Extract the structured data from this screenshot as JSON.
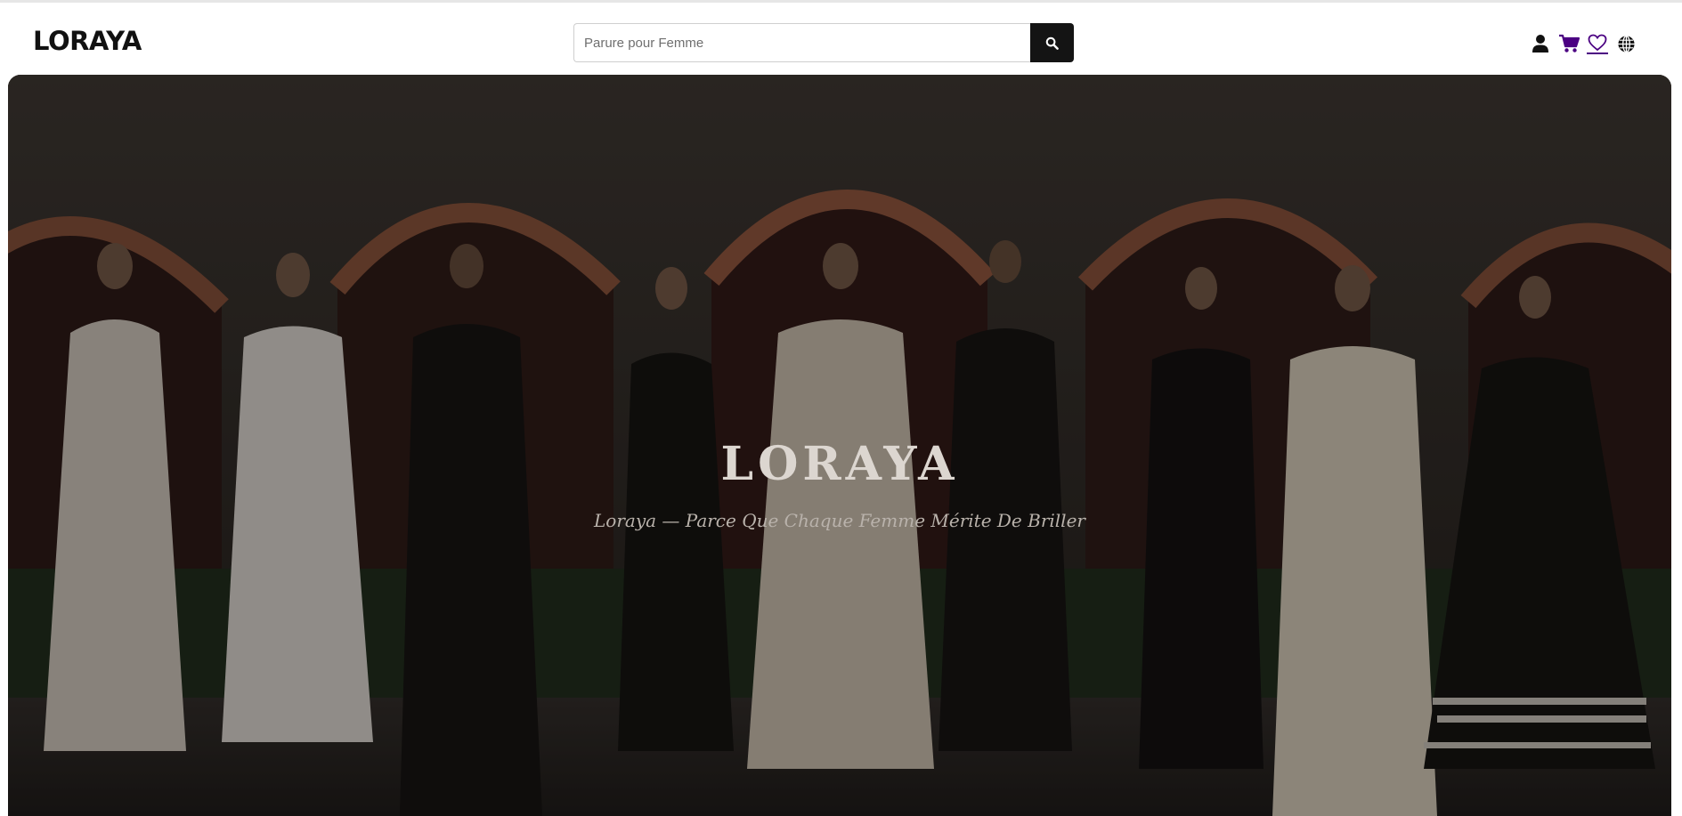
{
  "header": {
    "logo": "LORAYA",
    "search": {
      "placeholder": "Parure pour Femme",
      "value": ""
    },
    "icons": {
      "account": "user-icon",
      "cart": "cart-icon",
      "wishlist": "heart-icon",
      "language": "globe-icon"
    }
  },
  "hero": {
    "title": "LORAYA",
    "subtitle": "Loraya — Parce Que Chaque Femme Mérite De Briller"
  },
  "colors": {
    "accent_purple": "#4b0082",
    "search_button": "#141414",
    "text_dark": "#111111"
  }
}
